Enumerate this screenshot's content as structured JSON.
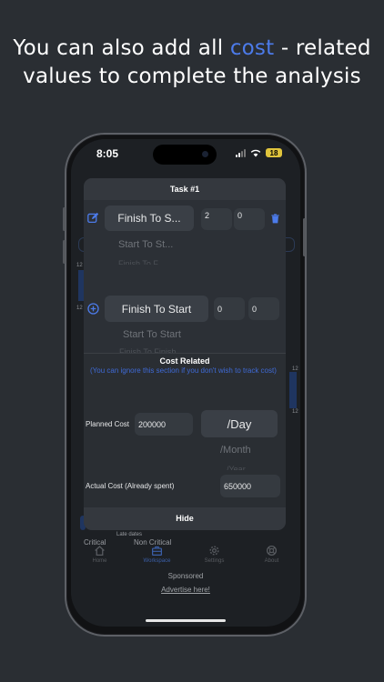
{
  "headline": {
    "pre": "You can also add all ",
    "accent": "cost",
    "post": " - related values to complete the analysis"
  },
  "status_bar": {
    "time": "8:05",
    "battery": "18",
    "icons": [
      "signal-icon",
      "wifi-icon",
      "battery-icon"
    ]
  },
  "modal": {
    "title": "Task #1",
    "dependency_1": {
      "type": "Finish To S...",
      "lag": "2",
      "value": "0",
      "wheel_next": "Start To St...",
      "wheel_next2": "Finish To F..."
    },
    "dependency_new": {
      "type": "Finish To Start",
      "lag": "0",
      "value": "0",
      "wheel_next": "Start To Start",
      "wheel_next2": "Finish To Finish"
    },
    "cost": {
      "title": "Cost Related",
      "note": "(You can ignore this section if you don't wish to track cost)",
      "planned_label": "Planned Cost",
      "planned_value": "200000",
      "period_selected": "/Day",
      "period_next": "/Month",
      "period_next2": "/Year",
      "actual_label": "Actual Cost (Already spent)",
      "actual_value": "650000"
    },
    "hide_label": "Hide"
  },
  "background": {
    "row_label_1": "12",
    "row_label_2": "12",
    "row_label_3": "12",
    "row_label_4": "12",
    "late_dates": "Late dates",
    "critical": "Critical",
    "non_critical": "Non Critical",
    "sponsored": "Sponsored",
    "advertise": "Advertise here!"
  },
  "tabs": [
    {
      "label": "Home",
      "icon": "home-icon"
    },
    {
      "label": "Workspace",
      "icon": "briefcase-icon"
    },
    {
      "label": "Settings",
      "icon": "gear-icon"
    },
    {
      "label": "About",
      "icon": "life-ring-icon"
    }
  ],
  "colors": {
    "accent": "#4c7bea",
    "background": "#2a2e33",
    "modal": "#2c3036",
    "battery": "#e0c43c"
  }
}
